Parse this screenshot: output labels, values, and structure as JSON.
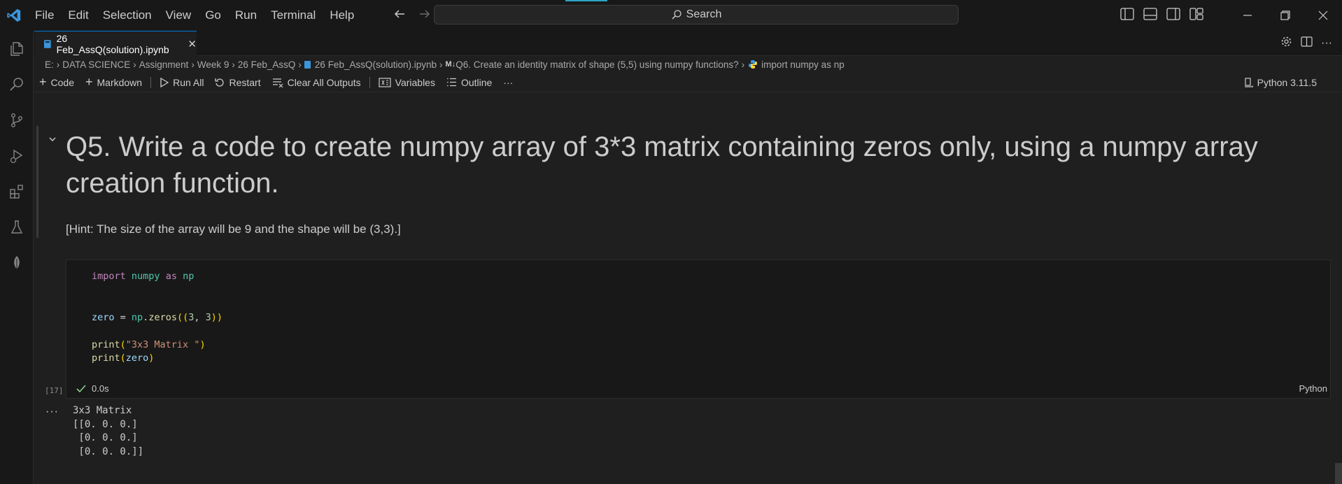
{
  "menu": [
    "File",
    "Edit",
    "Selection",
    "View",
    "Go",
    "Run",
    "Terminal",
    "Help"
  ],
  "search": {
    "label": "Search"
  },
  "tab": {
    "title": "26 Feb_AssQ(solution).ipynb"
  },
  "breadcrumb": [
    "E:",
    "DATA SCIENCE",
    "Assignment",
    "Week 9",
    "26 Feb_AssQ",
    "26 Feb_AssQ(solution).ipynb",
    "Q6. Create an identity matrix of shape (5,5) using numpy functions?",
    "import numpy as np"
  ],
  "breadcrumb_md_prefix": "M↓",
  "toolbar": {
    "code": "Code",
    "markdown": "Markdown",
    "run_all": "Run All",
    "restart": "Restart",
    "clear_outputs": "Clear All Outputs",
    "variables": "Variables",
    "outline": "Outline",
    "more": "···",
    "kernel": "Python 3.11.5"
  },
  "cell": {
    "heading": "Q5. Write a code to create numpy array of 3*3 matrix containing zeros only, using a numpy array creation function.",
    "hint": "[Hint: The size of the array will be 9 and the shape will be (3,3).]",
    "exec_count": "[17]",
    "exec_time": "0.0s",
    "language": "Python",
    "output_more": "···",
    "output_lines": [
      "3x3 Matrix",
      "[[0. 0. 0.]",
      " [0. 0. 0.]",
      " [0. 0. 0.]]"
    ]
  },
  "code_lines": {
    "l1": {
      "import": "import",
      "module": "numpy",
      "as": "as",
      "alias": "np"
    },
    "l2": {
      "var": "zero",
      "eq": " = ",
      "mod": "np",
      "dot": ".",
      "fn": "zeros",
      "open": "((",
      "n1": "3",
      "comma": ", ",
      "n2": "3",
      "close": "))"
    },
    "l3": {
      "fn": "print",
      "open": "(",
      "str": "\"3x3 Matrix \"",
      "close": ")"
    },
    "l4": {
      "fn": "print",
      "open": "(",
      "var": "zero",
      "close": ")"
    }
  },
  "colors": {
    "accent": "#0078d4",
    "check": "#89d185",
    "logo": "#3a96dd"
  }
}
